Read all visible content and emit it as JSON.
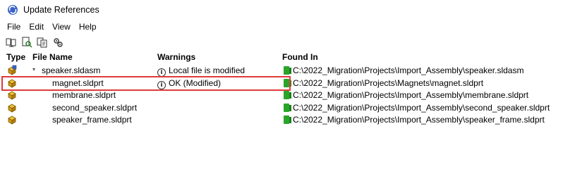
{
  "window": {
    "title": "Update References"
  },
  "menu": [
    "File",
    "Edit",
    "View",
    "Help"
  ],
  "toolbar": {
    "icons": [
      "update-references-icon",
      "find-icon",
      "copy-references-icon",
      "options-icon"
    ]
  },
  "columns": {
    "type": "Type",
    "file_name": "File Name",
    "warnings": "Warnings",
    "found_in": "Found In"
  },
  "rows": [
    {
      "type": "assembly",
      "file_name": "speaker.sldasm",
      "warning": "Local file is modified",
      "found_in": "C:\\2022_Migration\\Projects\\Import_Assembly\\speaker.sldasm",
      "expanded": true
    },
    {
      "type": "part",
      "file_name": "magnet.sldprt",
      "warning": "OK (Modified)",
      "found_in": "C:\\2022_Migration\\Projects\\Magnets\\magnet.sldprt",
      "highlighted": true
    },
    {
      "type": "part",
      "file_name": "membrane.sldprt",
      "warning": "",
      "found_in": "C:\\2022_Migration\\Projects\\Import_Assembly\\membrane.sldprt"
    },
    {
      "type": "part",
      "file_name": "second_speaker.sldprt",
      "warning": "",
      "found_in": "C:\\2022_Migration\\Projects\\Import_Assembly\\second_speaker.sldprt"
    },
    {
      "type": "part",
      "file_name": "speaker_frame.sldprt",
      "warning": "",
      "found_in": "C:\\2022_Migration\\Projects\\Import_Assembly\\speaker_frame.sldprt"
    }
  ]
}
